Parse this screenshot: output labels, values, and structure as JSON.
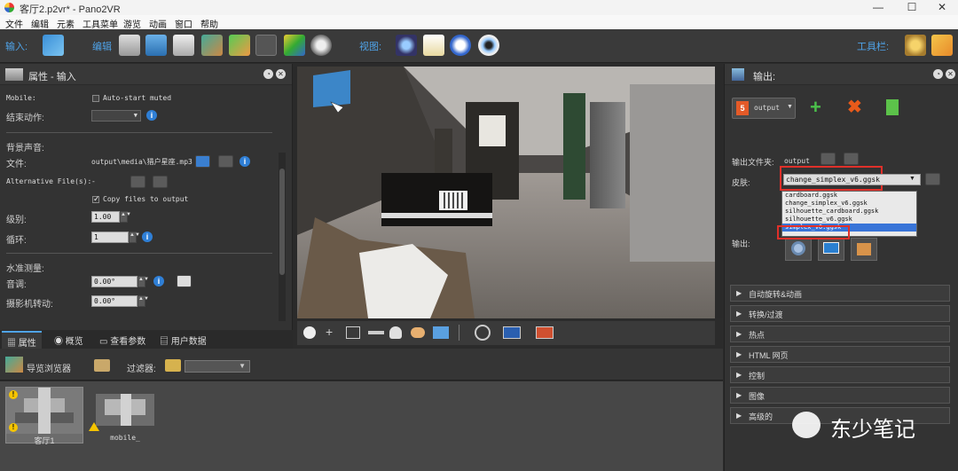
{
  "window": {
    "title": "客厅2.p2vr* - Pano2VR"
  },
  "menu": [
    "文件",
    "编辑",
    "元素",
    "工具菜单",
    "游览",
    "动画",
    "窗口",
    "帮助"
  ],
  "toolbar": {
    "input_label": "输入:",
    "edit_label": "编辑",
    "view_label": "视图:",
    "toolbar_label": "工具栏:"
  },
  "left_panel": {
    "title": "属性 - 输入",
    "mobile_label": "Mobile:",
    "autostart_label": "Auto-start muted",
    "end_action_label": "结束动作:",
    "bg_sound_label": "背景声音:",
    "file_label": "文件:",
    "file_value": "output\\media\\猎户星座.mp3",
    "alt_files_label": "Alternative File(s):",
    "alt_files_value": "-",
    "copy_files_label": "Copy files to output",
    "level_label": "级别:",
    "level_value": "1.00",
    "loop_label": "循环:",
    "loop_value": "1",
    "level_meter_label": "水准测量:",
    "pitch_label": "音调:",
    "pitch_value": "0.00°",
    "camera_roll_label": "摄影机转动:",
    "camera_roll_value": "0.00°"
  },
  "left_tabs": [
    "属性",
    "概览",
    "查看参数",
    "用户数据"
  ],
  "tour_browser": {
    "title": "导览浏览器",
    "filter_label": "过滤器:",
    "nodes": [
      {
        "label": "客厅1"
      },
      {
        "label": "mobile_"
      }
    ]
  },
  "right_panel": {
    "title": "输出:",
    "output_button": "output",
    "output_folder_label": "输出文件夹:",
    "output_folder_value": "output",
    "skin_label": "皮肤:",
    "skin_value": "change_simplex_v6.ggsk",
    "skin_options": [
      "cardboard.ggsk",
      "change_simplex_v6.ggsk",
      "silhouette_cardboard.ggsk",
      "silhouette_v6.ggsk",
      "simplex_v6.ggsk"
    ],
    "skin_selected_index": 4,
    "output_label": "输出:",
    "sections": [
      "自动旋转&动画",
      "转换/过渡",
      "热点",
      "HTML 网页",
      "控制",
      "图像",
      "高级的"
    ]
  },
  "watermark": {
    "text": "东少笔记"
  },
  "colors": {
    "accent": "#4fa3e8",
    "highlight_box": "#e0302a",
    "selection": "#3874d8"
  }
}
